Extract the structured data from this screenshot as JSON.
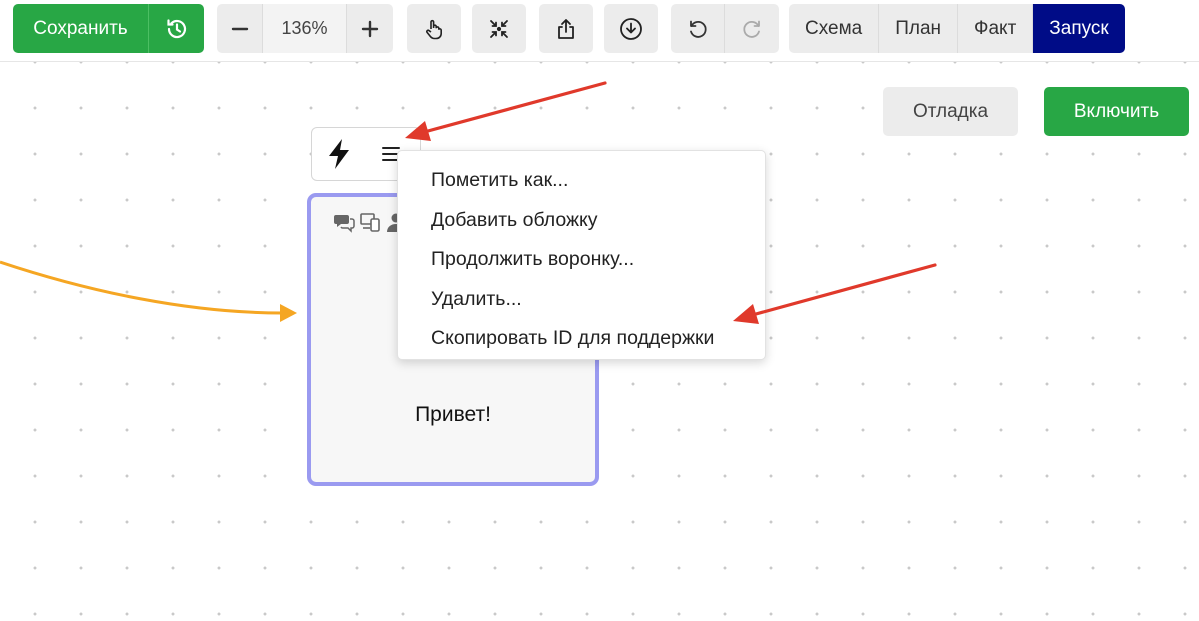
{
  "toolbar": {
    "save_label": "Сохранить",
    "zoom_value": "136%",
    "modes": [
      {
        "label": "Схема",
        "active": false
      },
      {
        "label": "План",
        "active": false
      },
      {
        "label": "Факт",
        "active": false
      },
      {
        "label": "Запуск",
        "active": true
      }
    ],
    "icons": [
      "history-icon",
      "minus-icon",
      "plus-icon",
      "hand-icon",
      "collapse-icon",
      "share-icon",
      "download-icon",
      "undo-icon",
      "redo-icon"
    ]
  },
  "actions": {
    "debug_label": "Отладка",
    "enable_label": "Включить"
  },
  "node_toolbar": {
    "icons": [
      "lightning-icon",
      "menu-icon"
    ]
  },
  "context_menu": {
    "items": [
      "Пометить как...",
      "Добавить обложку",
      "Продолжить воронку...",
      "Удалить...",
      "Скопировать ID для поддержки"
    ]
  },
  "node": {
    "text": "Привет!",
    "icons": [
      "chat-icon",
      "devices-icon",
      "user-icon"
    ]
  },
  "colors": {
    "primary_green": "#28a745",
    "active_mode": "#000c87",
    "node_border": "#9a9af0",
    "annotation_arrow": "#e0392b",
    "connector": "#f5a623"
  }
}
